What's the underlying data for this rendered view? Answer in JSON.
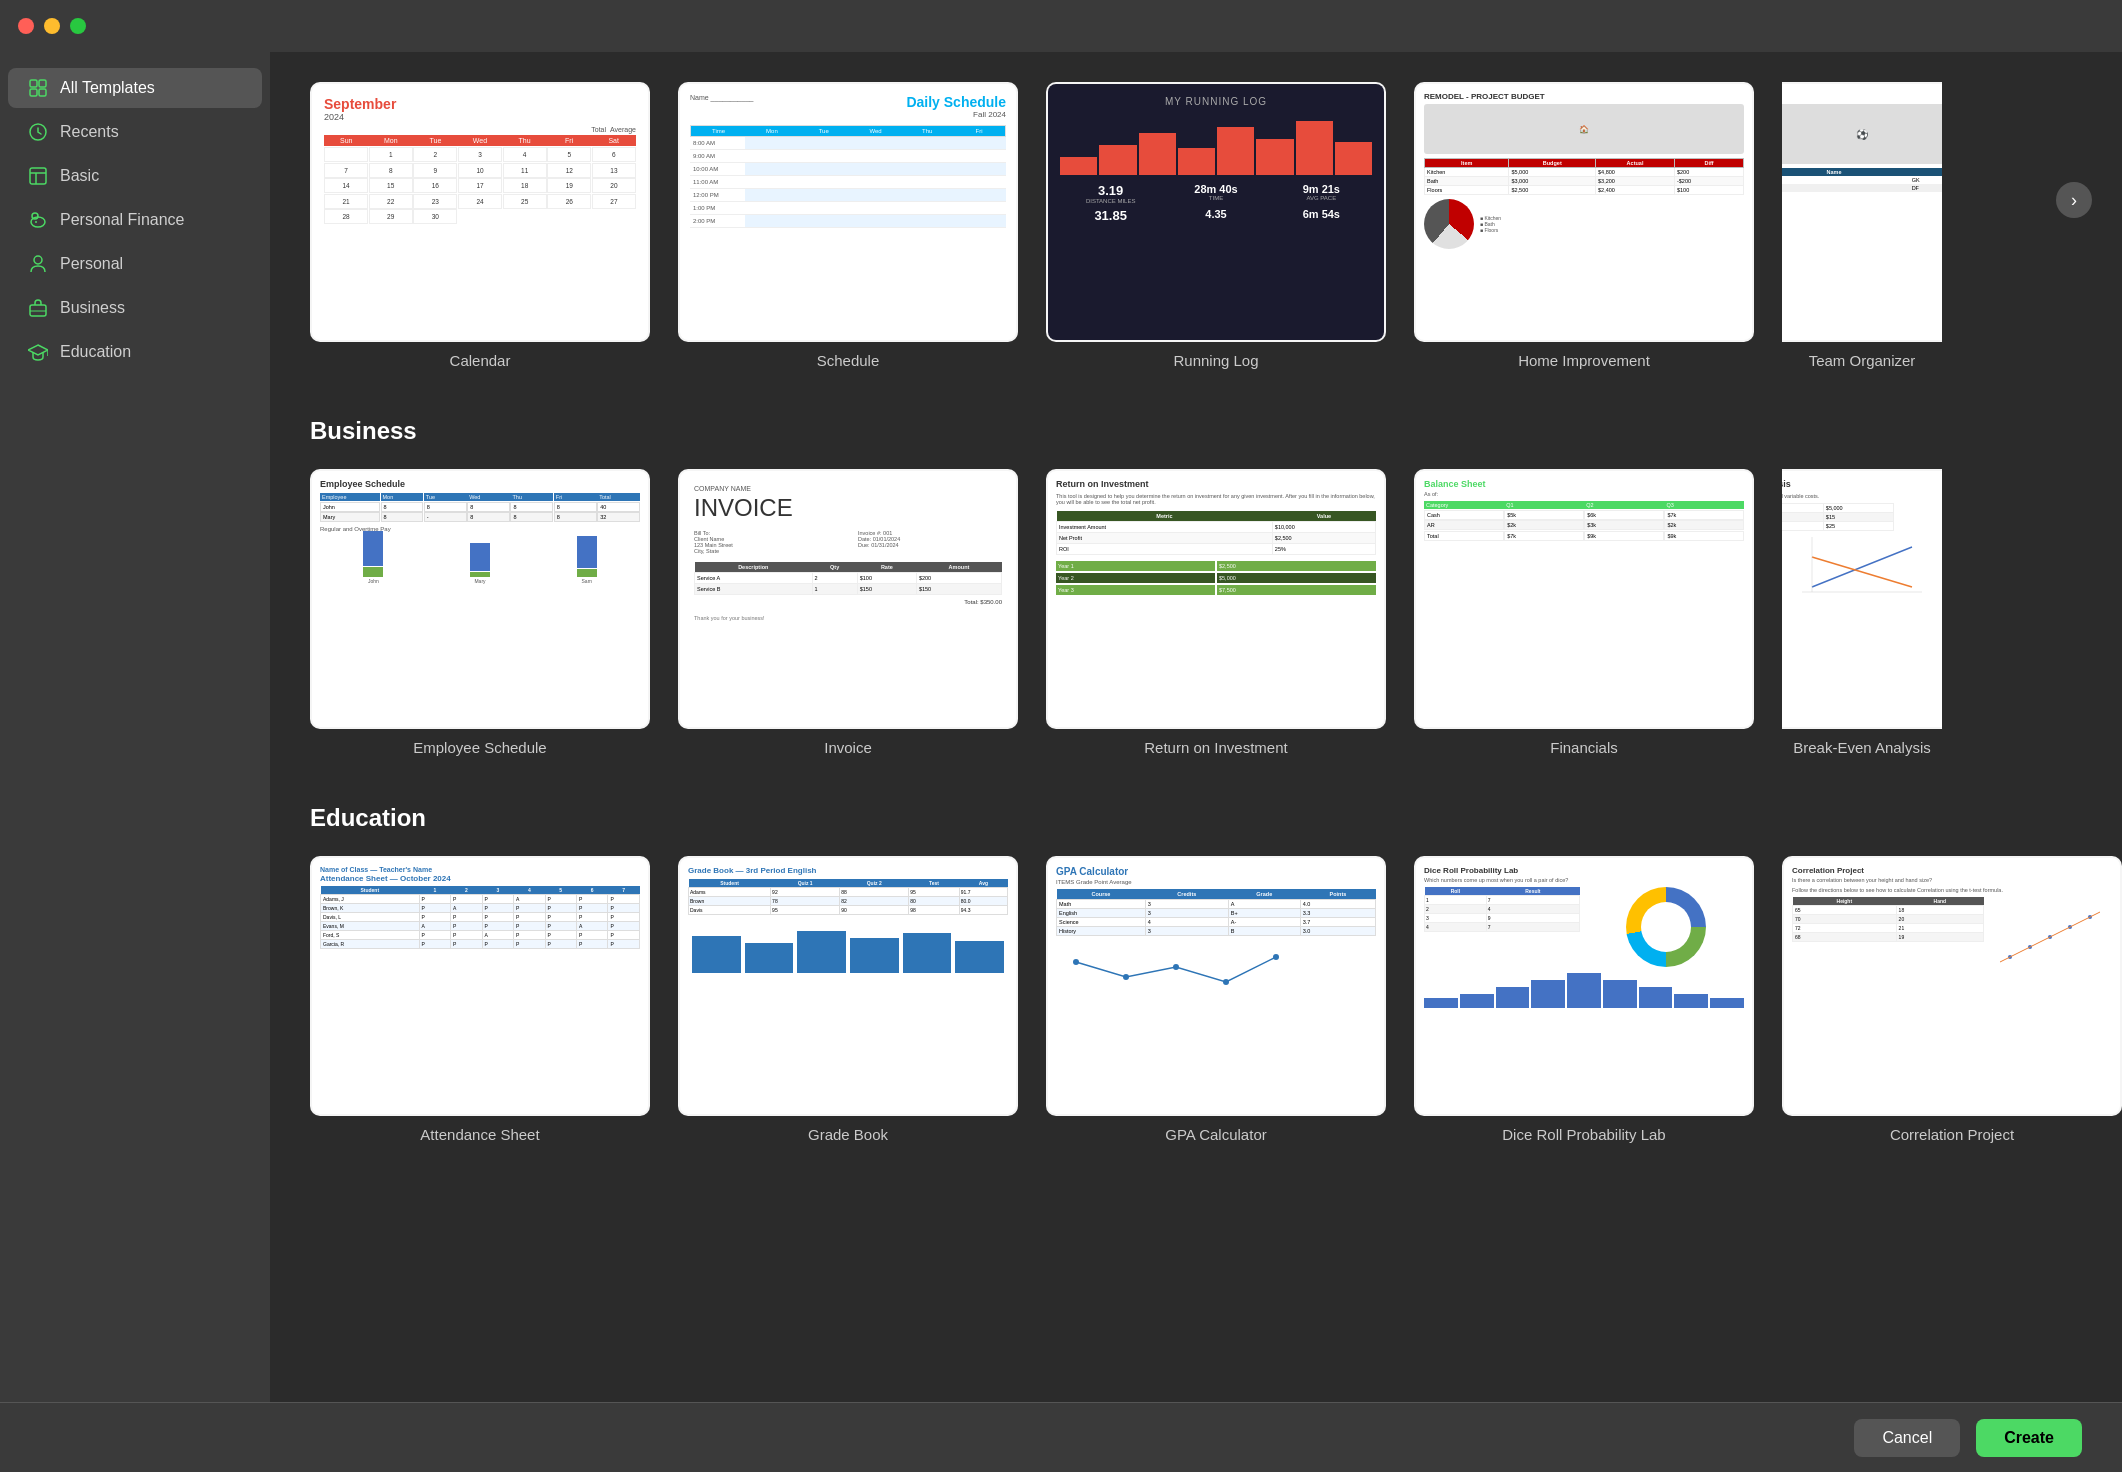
{
  "titleBar": {
    "trafficLights": [
      "red",
      "yellow",
      "green"
    ]
  },
  "sidebar": {
    "items": [
      {
        "id": "all-templates",
        "label": "All Templates",
        "icon": "grid",
        "active": true
      },
      {
        "id": "recents",
        "label": "Recents",
        "icon": "clock",
        "active": false
      },
      {
        "id": "basic",
        "label": "Basic",
        "icon": "table",
        "active": false
      },
      {
        "id": "personal-finance",
        "label": "Personal Finance",
        "icon": "piggy",
        "active": false
      },
      {
        "id": "personal",
        "label": "Personal",
        "icon": "person",
        "active": false
      },
      {
        "id": "business",
        "label": "Business",
        "icon": "briefcase",
        "active": false
      },
      {
        "id": "education",
        "label": "Education",
        "icon": "mortarboard",
        "active": false
      }
    ]
  },
  "sections": {
    "allTemplates": "All Templates",
    "business": "Business",
    "education": "Education"
  },
  "topTemplates": [
    {
      "id": "calendar",
      "label": "Calendar"
    },
    {
      "id": "schedule",
      "label": "Schedule"
    },
    {
      "id": "running-log",
      "label": "Running Log"
    },
    {
      "id": "home-improvement",
      "label": "Home Improvement"
    },
    {
      "id": "team-organizer",
      "label": "Team Organizer"
    }
  ],
  "businessTemplates": [
    {
      "id": "employee-schedule",
      "label": "Employee Schedule"
    },
    {
      "id": "invoice",
      "label": "Invoice"
    },
    {
      "id": "return-on-investment",
      "label": "Return on Investment"
    },
    {
      "id": "financials",
      "label": "Financials"
    },
    {
      "id": "break-even-analysis",
      "label": "Break-Even Analysis"
    }
  ],
  "educationTemplates": [
    {
      "id": "attendance-sheet",
      "label": "Attendance Sheet"
    },
    {
      "id": "grade-book",
      "label": "Grade Book"
    },
    {
      "id": "gpa-calculator",
      "label": "GPA Calculator"
    },
    {
      "id": "dice-roll",
      "label": "Dice Roll Probability Lab"
    },
    {
      "id": "correlation-project",
      "label": "Correlation Project"
    }
  ],
  "calendarThumb": {
    "month": "September",
    "year": "2024",
    "days": [
      "Sun",
      "Mon",
      "Tue",
      "Wed",
      "Thu",
      "Fri",
      "Sat"
    ],
    "cells": [
      "1",
      "2",
      "3",
      "4",
      "5",
      "6",
      "7",
      "8",
      "9",
      "10",
      "11",
      "12",
      "13",
      "14",
      "15",
      "16",
      "17",
      "18",
      "19",
      "20",
      "21",
      "22",
      "23",
      "24",
      "25",
      "26",
      "27",
      "28",
      "29",
      "30",
      "",
      "",
      "",
      "",
      ""
    ]
  },
  "scheduleThumb": {
    "title": "Daily Schedule",
    "subtitle": "Fall 2024"
  },
  "buttons": {
    "cancel": "Cancel",
    "create": "Create"
  }
}
